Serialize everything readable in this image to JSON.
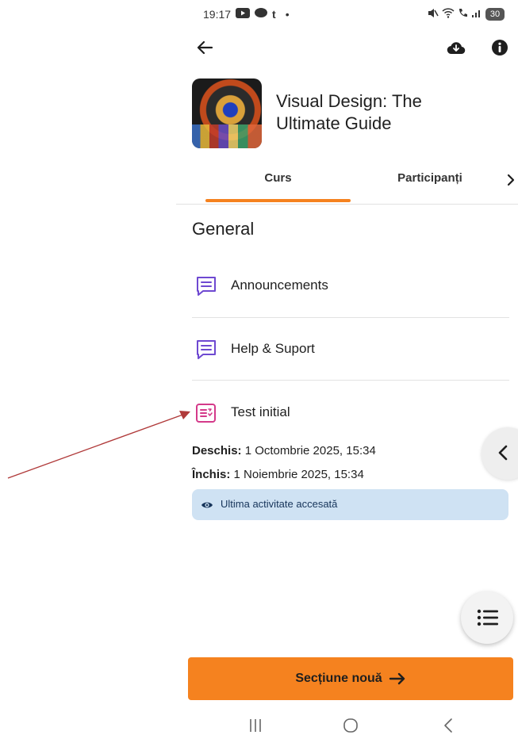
{
  "status_bar": {
    "time": "19:17",
    "notification_t": "t",
    "dot": "•",
    "battery": "30"
  },
  "course": {
    "title": "Visual Design: The Ultimate Guide"
  },
  "tabs": [
    {
      "label": "Curs",
      "active": true
    },
    {
      "label": "Participanți",
      "active": false
    }
  ],
  "section": {
    "title": "General",
    "modules": [
      {
        "label": "Announcements",
        "type": "forum"
      },
      {
        "label": "Help & Suport",
        "type": "forum"
      },
      {
        "label": "Test initial",
        "type": "quiz"
      }
    ],
    "dates": {
      "opened_label": "Deschis:",
      "opened_value": " 1 Octombrie 2025, 15:34",
      "closed_label": "Închis:",
      "closed_value": " 1 Noiembrie 2025, 15:34"
    },
    "last_activity": "Ultima activitate accesată"
  },
  "next_section": {
    "label": "Secțiune nouă"
  },
  "colors": {
    "accent": "#f5821f",
    "forum_icon": "#6e49d1",
    "quiz_icon": "#d43a8a",
    "badge_bg": "#cfe2f3",
    "annotation": "#b03a3a"
  }
}
